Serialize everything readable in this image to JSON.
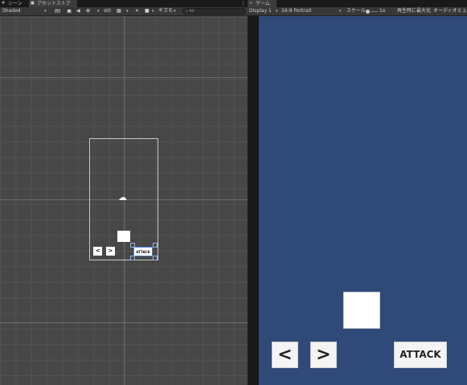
{
  "scene_tabs": [
    {
      "label": "シーン",
      "icon": "hash-icon"
    },
    {
      "label": "アセットストア",
      "icon": "lock-icon"
    }
  ],
  "scene_toolbar": {
    "shading_mode": "Shaded",
    "mode_2d": "2D",
    "gizmos": "ギズモ",
    "search_text": "All"
  },
  "game_tab": {
    "label": "ゲーム",
    "icon": "gamepad-icon"
  },
  "game_toolbar": {
    "display": "Display 1",
    "aspect": "16:9 Portrait",
    "scale_label": "スケール",
    "scale_value": "1x",
    "maximize": "再生時に最大化",
    "audio": "オーディオミュート"
  },
  "scene_view": {
    "left_label": "<",
    "right_label": ">",
    "attack_label": "ATTACK"
  },
  "game_view": {
    "left_label": "<",
    "right_label": ">",
    "attack_label": "ATTACK"
  },
  "colors": {
    "game_bg": "#2f4a78",
    "scene_bg": "#474747",
    "ui_bg": "#191919"
  }
}
